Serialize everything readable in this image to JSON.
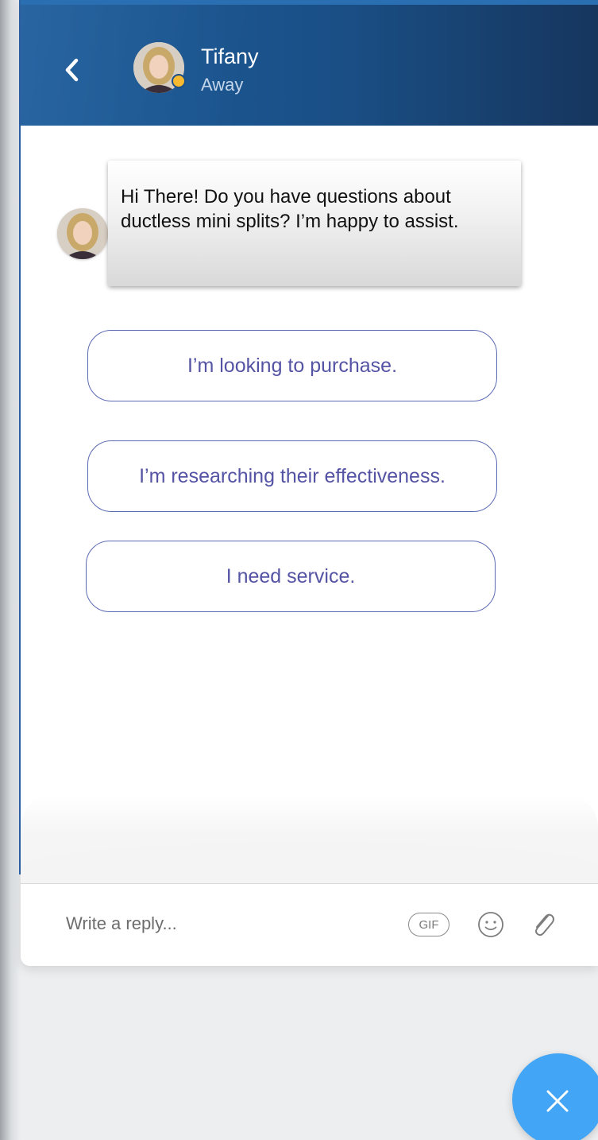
{
  "header": {
    "agent_name": "Tifany",
    "agent_status": "Away",
    "status_color": "#f6b930",
    "background": "#1a4f86",
    "icons": {
      "back": "chevron-left-icon"
    }
  },
  "message": {
    "text": "Hi There! Do you have questions about ductless mini splits? I’m happy to assist."
  },
  "options": [
    {
      "label": "I’m looking to purchase."
    },
    {
      "label": "I’m researching their effectiveness."
    },
    {
      "label": "I need service."
    }
  ],
  "composer": {
    "placeholder": "Write a reply...",
    "gif_label": "GIF",
    "icons": {
      "emoji": "smiley-icon",
      "attach": "paperclip-icon"
    }
  },
  "fab": {
    "icon": "close-icon",
    "color": "#42a5f5"
  }
}
